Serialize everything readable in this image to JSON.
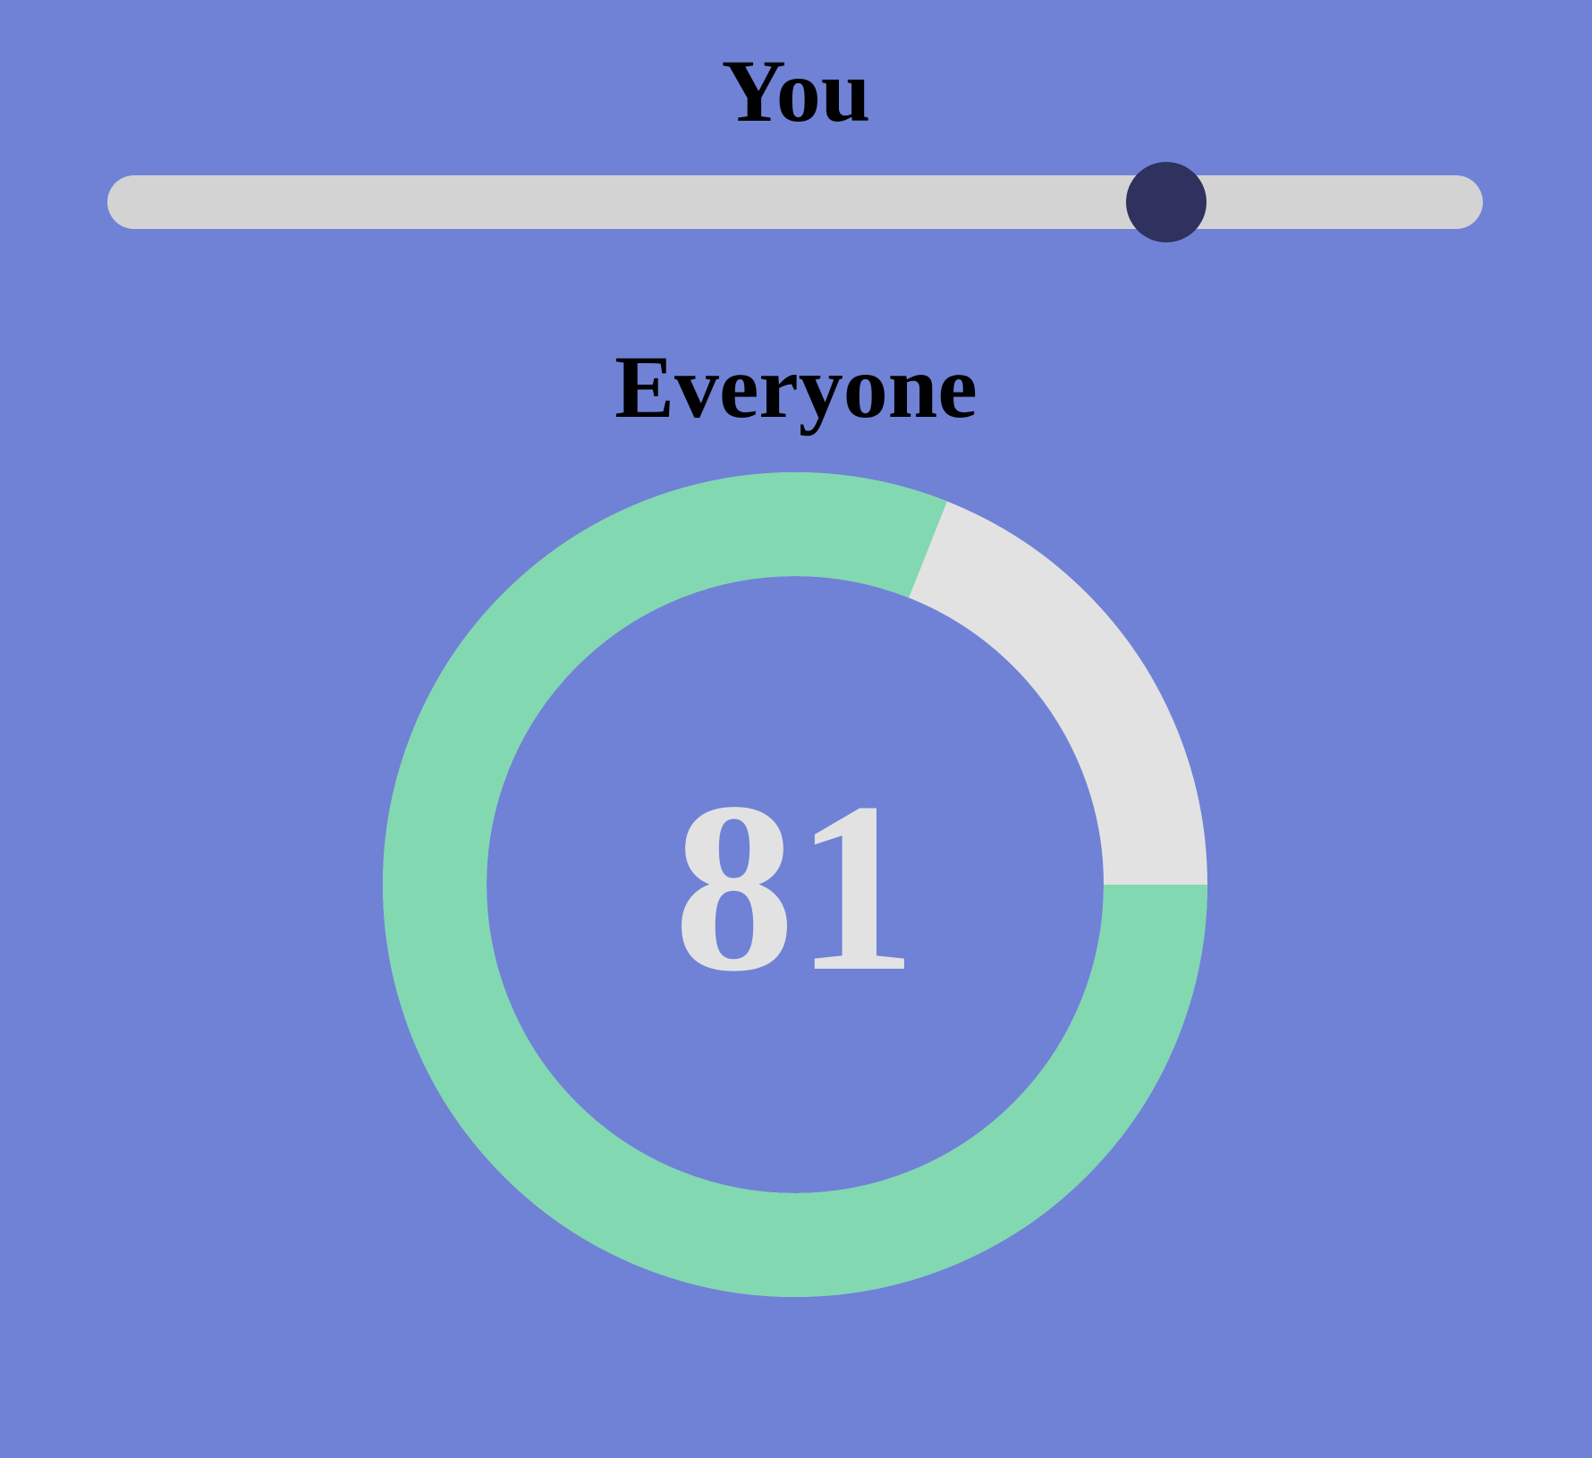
{
  "you": {
    "title": "You",
    "slider_value": 0.77
  },
  "everyone": {
    "title": "Everyone",
    "value": "81",
    "percent": 81
  },
  "colors": {
    "background": "#6f82d6",
    "track": "#d3d3d3",
    "thumb": "#2f315e",
    "donut_filled": "#82d8b0",
    "donut_empty": "#e2e2e2",
    "value_text": "#e2e2e2"
  }
}
